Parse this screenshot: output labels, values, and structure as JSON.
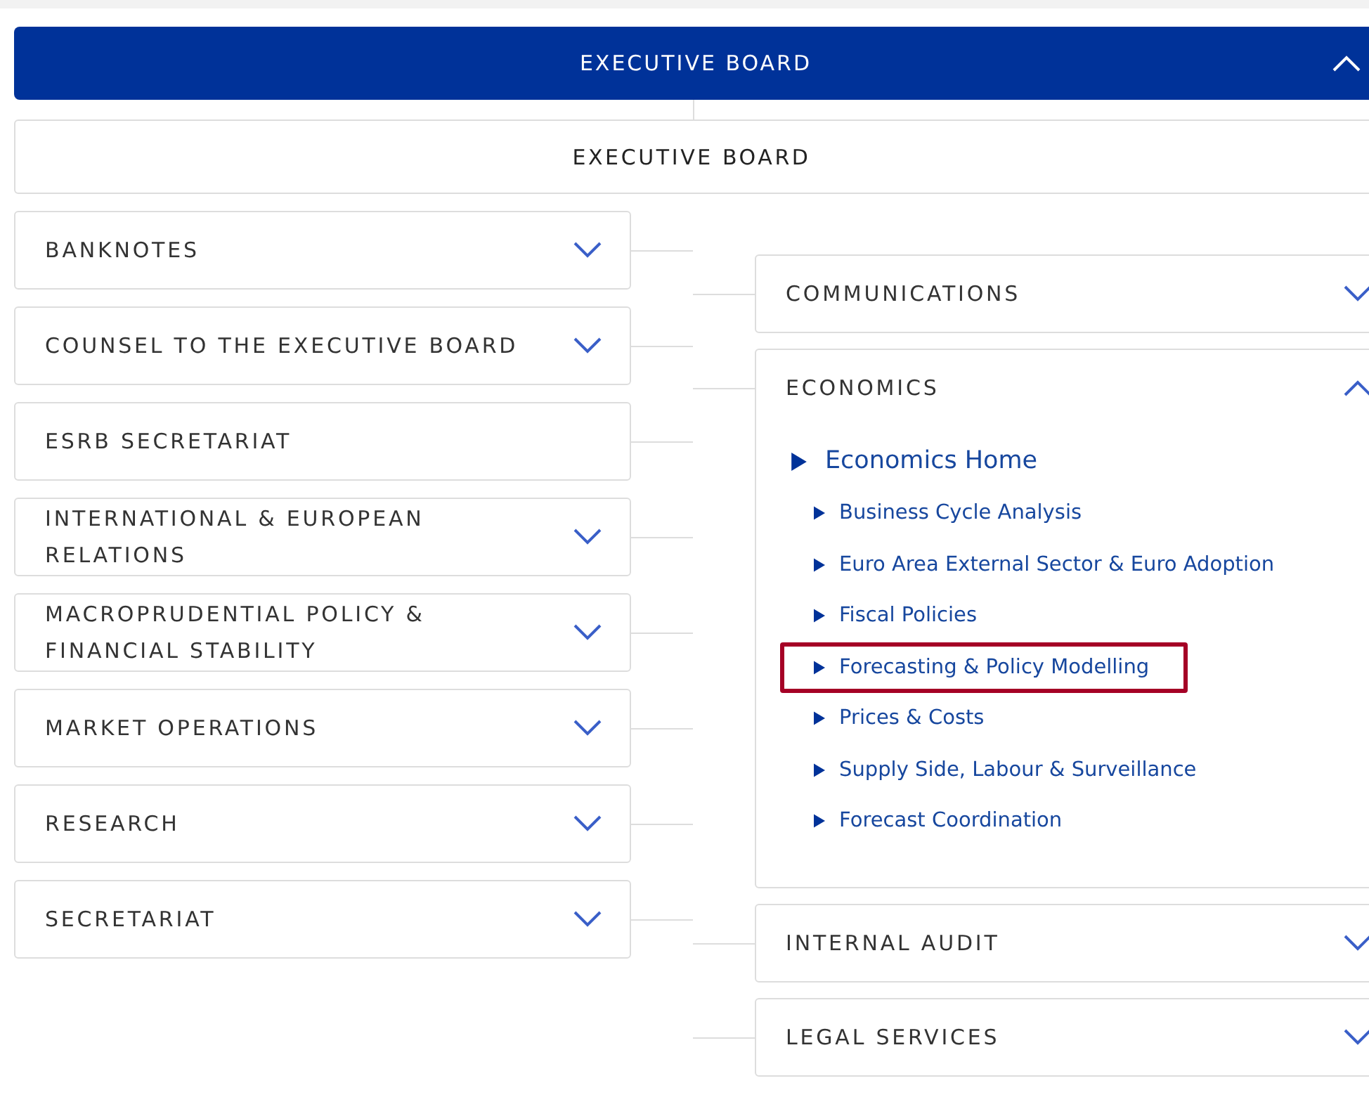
{
  "header": {
    "title": "EXECUTIVE BOARD",
    "expanded": true
  },
  "board": {
    "label": "EXECUTIVE BOARD"
  },
  "left_units": [
    {
      "label": "BANKNOTES",
      "expandable": true
    },
    {
      "label": "COUNSEL TO THE EXECUTIVE BOARD",
      "expandable": true
    },
    {
      "label": "ESRB SECRETARIAT",
      "expandable": false
    },
    {
      "label": "INTERNATIONAL & EUROPEAN RELATIONS",
      "expandable": true
    },
    {
      "label": "MACROPRUDENTIAL POLICY & FINANCIAL STABILITY",
      "expandable": true
    },
    {
      "label": "MARKET OPERATIONS",
      "expandable": true
    },
    {
      "label": "RESEARCH",
      "expandable": true
    },
    {
      "label": "SECRETARIAT",
      "expandable": true
    }
  ],
  "right_units": [
    {
      "label": "COMMUNICATIONS",
      "expandable": true,
      "expanded": false
    },
    {
      "label": "ECONOMICS",
      "expandable": true,
      "expanded": true,
      "links": [
        {
          "label": "Economics Home",
          "kind": "home",
          "highlighted": false
        },
        {
          "label": "Business Cycle Analysis",
          "kind": "sub",
          "highlighted": false
        },
        {
          "label": "Euro Area External Sector & Euro Adoption",
          "kind": "sub",
          "highlighted": false
        },
        {
          "label": "Fiscal Policies",
          "kind": "sub",
          "highlighted": false
        },
        {
          "label": "Forecasting & Policy Modelling",
          "kind": "sub",
          "highlighted": true
        },
        {
          "label": "Prices & Costs",
          "kind": "sub",
          "highlighted": false
        },
        {
          "label": "Supply Side, Labour & Surveillance",
          "kind": "sub",
          "highlighted": false
        },
        {
          "label": "Forecast Coordination",
          "kind": "sub",
          "highlighted": false
        }
      ]
    },
    {
      "label": "INTERNAL AUDIT",
      "expandable": true,
      "expanded": false
    },
    {
      "label": "LEGAL SERVICES",
      "expandable": true,
      "expanded": false
    }
  ]
}
